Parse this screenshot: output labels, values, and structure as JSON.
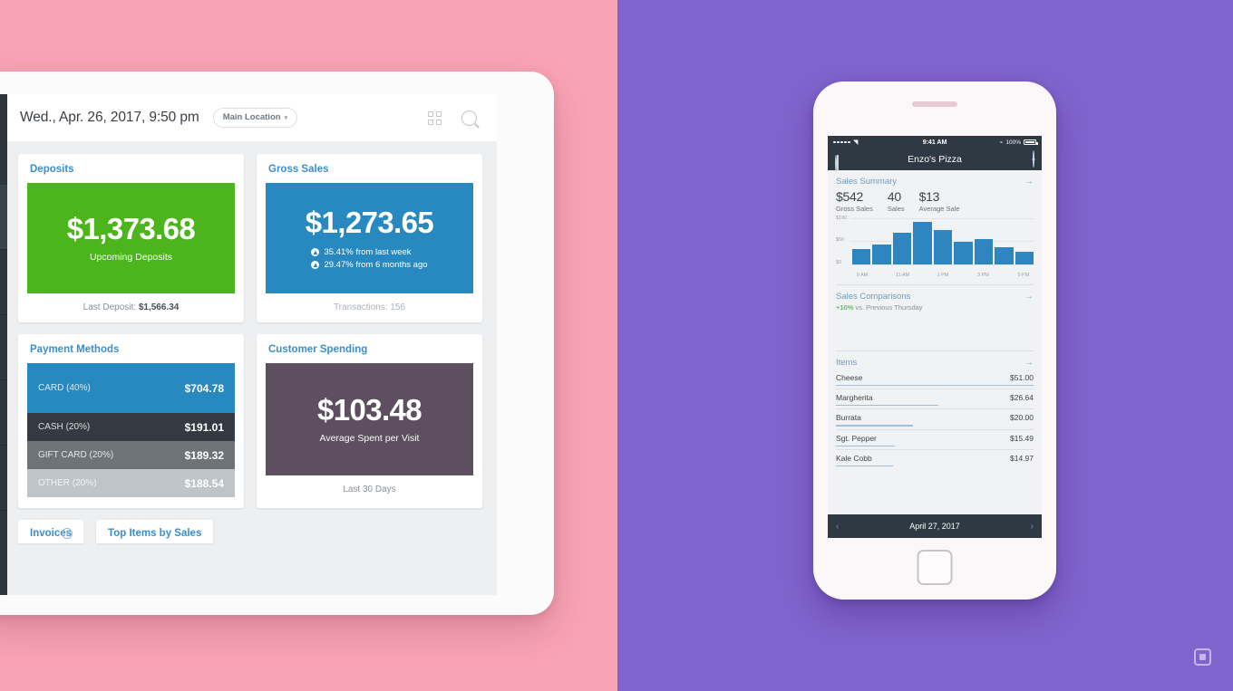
{
  "background": {
    "left_color": "#F9A3B6",
    "right_color": "#8064CE"
  },
  "tablet": {
    "header": {
      "date": "Wed., Apr. 26, 2017, 9:50 pm",
      "location": "Main Location",
      "caret": "▾",
      "grid_icon": "grid-icon",
      "search_icon": "search-icon"
    },
    "cards": {
      "deposits": {
        "title": "Deposits",
        "amount": "$1,373.68",
        "subtitle": "Upcoming Deposits",
        "footer_label": "Last Deposit:",
        "footer_value": "$1,566.34",
        "color": "#4CB51C"
      },
      "gross_sales": {
        "title": "Gross Sales",
        "amount": "$1,273.65",
        "line1": "35.41% from last week",
        "line2": "29.47% from 6 months ago",
        "footer": "Transactions: 156",
        "color": "#2789BF"
      },
      "payment_methods": {
        "title": "Payment Methods",
        "rows": [
          {
            "name": "CARD",
            "pct": "(40%)",
            "value": "$704.78",
            "color": "#2789BF"
          },
          {
            "name": "CASH",
            "pct": "(20%)",
            "value": "$191.01",
            "color": "#333A41"
          },
          {
            "name": "GIFT CARD",
            "pct": "(20%)",
            "value": "$189.32",
            "color": "#6E7377"
          },
          {
            "name": "OTHER",
            "pct": "(20%)",
            "value": "$188.54",
            "color": "#BFC4C8"
          }
        ]
      },
      "customer_spending": {
        "title": "Customer Spending",
        "amount": "$103.48",
        "subtitle": "Average Spent per Visit",
        "footer": "Last 30 Days",
        "color": "#5D4F60"
      },
      "invoices": {
        "title": "Invoices",
        "info_icon": "info-icon"
      },
      "top_items": {
        "title": "Top Items by Sales"
      }
    }
  },
  "phone": {
    "status": {
      "time": "9:41 AM",
      "battery": "100%"
    },
    "nav": {
      "title": "Enzo's Pizza",
      "left_icon": "person-icon",
      "right_icon": "location-pin-icon"
    },
    "sales_summary": {
      "title": "Sales Summary",
      "arrow": "→",
      "metrics": [
        {
          "value": "$542",
          "label": "Gross Sales"
        },
        {
          "value": "40",
          "label": "Sales"
        },
        {
          "value": "$13",
          "label": "Average Sale"
        }
      ]
    },
    "sales_comparisons": {
      "title": "Sales Comparisons",
      "arrow": "→",
      "delta": "+10%",
      "text": "vs. Previous Thursday"
    },
    "items": {
      "title": "Items",
      "arrow": "→",
      "rows": [
        {
          "name": "Cheese",
          "value": "$51.00",
          "bar_pct": 100
        },
        {
          "name": "Margherita",
          "value": "$26.64",
          "bar_pct": 52
        },
        {
          "name": "Burrata",
          "value": "$20.00",
          "bar_pct": 39
        },
        {
          "name": "Sgt. Pepper",
          "value": "$15.49",
          "bar_pct": 30
        },
        {
          "name": "Kale Cobb",
          "value": "$14.97",
          "bar_pct": 29
        }
      ]
    },
    "date_bar": {
      "date": "April 27, 2017",
      "prev": "‹",
      "next": "›"
    }
  },
  "watermark": {
    "icon": "square-badge-icon"
  },
  "chart_data": {
    "type": "bar",
    "title": "Sales Summary",
    "categories": [
      "9 AM",
      "10 AM",
      "11 AM",
      "12 PM",
      "1 PM",
      "2 PM",
      "3 PM",
      "4 PM",
      "5 PM"
    ],
    "tick_labels": [
      "9 AM",
      "",
      "11 AM",
      "",
      "1 PM",
      "",
      "3 PM",
      "",
      "5 PM"
    ],
    "values": [
      38,
      48,
      78,
      105,
      85,
      55,
      62,
      42,
      30
    ],
    "ylabel": "",
    "xlabel": "",
    "ylim": [
      0,
      115
    ],
    "yticks": [
      "$0",
      "$50",
      "$100"
    ],
    "bar_color": "#2E86C0",
    "grid": true,
    "legend": false
  }
}
